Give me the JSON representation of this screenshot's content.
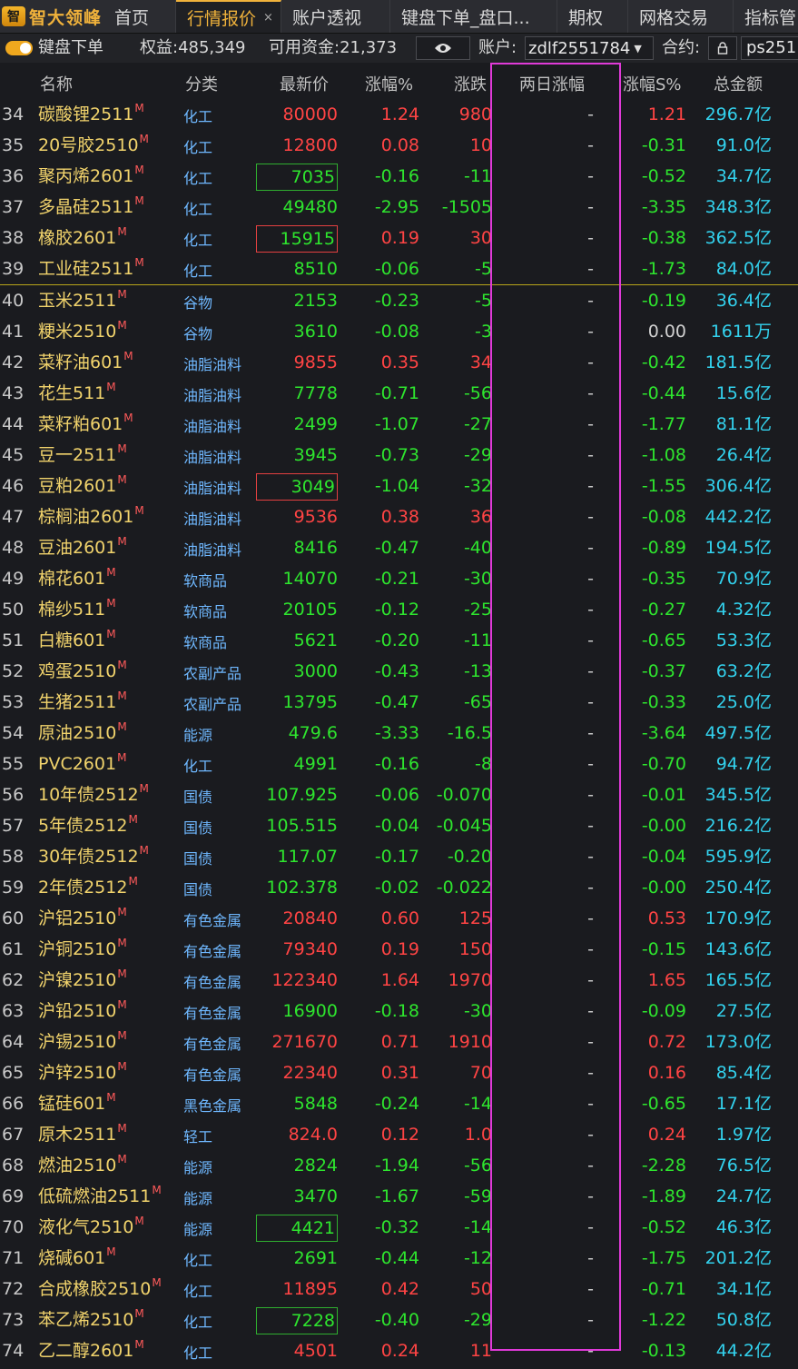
{
  "brand": {
    "name": "智大领峰",
    "mark": "智"
  },
  "tabs": [
    {
      "label": "首页"
    },
    {
      "label": "行情报价",
      "close": "×"
    },
    {
      "label": "账户透视"
    },
    {
      "label": "键盘下单_盘口..."
    },
    {
      "label": "期权"
    },
    {
      "label": "网格交易"
    },
    {
      "label": "指标管"
    }
  ],
  "toolbar": {
    "toggle_label": "键盘下单",
    "equity": "权益:485,349",
    "available": "可用资金:21,373",
    "account_label": "账户:",
    "account_value": "zdlf2551784",
    "contract_label": "合约:",
    "contract_value": "ps251"
  },
  "columns": [
    "名称",
    "分类",
    "最新价",
    "涨幅%",
    "涨跌",
    "两日涨幅",
    "涨幅S%",
    "总金额"
  ],
  "rows": [
    {
      "idx": "34",
      "name": "碳酸锂2511",
      "mark": "M",
      "cat": "化工",
      "price": "80000",
      "pct": "1.24",
      "chg": "980",
      "two": "-",
      "pcts": "1.21",
      "amt": "296.7亿",
      "dir": "up",
      "sdir": "up"
    },
    {
      "idx": "35",
      "name": "20号胶2510",
      "mark": "M",
      "cat": "化工",
      "price": "12800",
      "pct": "0.08",
      "chg": "10",
      "two": "-",
      "pcts": "-0.31",
      "amt": "91.0亿",
      "dir": "up",
      "sdir": "down"
    },
    {
      "idx": "36",
      "name": "聚丙烯2601",
      "mark": "M",
      "cat": "化工",
      "price": "7035",
      "pct": "-0.16",
      "chg": "-11",
      "two": "-",
      "pcts": "-0.52",
      "amt": "34.7亿",
      "dir": "down",
      "sdir": "down",
      "boxed": true
    },
    {
      "idx": "37",
      "name": "多晶硅2511",
      "mark": "M",
      "cat": "化工",
      "price": "49480",
      "pct": "-2.95",
      "chg": "-1505",
      "two": "-",
      "pcts": "-3.35",
      "amt": "348.3亿",
      "dir": "down",
      "sdir": "down"
    },
    {
      "idx": "38",
      "name": "橡胶2601",
      "mark": "M",
      "cat": "化工",
      "price": "15915",
      "pct": "0.19",
      "chg": "30",
      "two": "-",
      "pcts": "-0.38",
      "amt": "362.5亿",
      "dir": "up",
      "sdir": "down",
      "boxed": true,
      "box_color": "down"
    },
    {
      "idx": "39",
      "name": "工业硅2511",
      "mark": "M",
      "cat": "化工",
      "price": "8510",
      "pct": "-0.06",
      "chg": "-5",
      "two": "-",
      "pcts": "-1.73",
      "amt": "84.0亿",
      "dir": "down",
      "sdir": "down"
    },
    {
      "idx": "40",
      "name": "玉米2511",
      "mark": "M",
      "cat": "谷物",
      "price": "2153",
      "pct": "-0.23",
      "chg": "-5",
      "two": "-",
      "pcts": "-0.19",
      "amt": "36.4亿",
      "dir": "down",
      "sdir": "down",
      "sep": true
    },
    {
      "idx": "41",
      "name": "粳米2510",
      "mark": "M",
      "cat": "谷物",
      "price": "3610",
      "pct": "-0.08",
      "chg": "-3",
      "two": "-",
      "pcts": "0.00",
      "amt": "1611万",
      "dir": "down",
      "sdir": "flat"
    },
    {
      "idx": "42",
      "name": "菜籽油601",
      "mark": "M",
      "cat": "油脂油料",
      "price": "9855",
      "pct": "0.35",
      "chg": "34",
      "two": "-",
      "pcts": "-0.42",
      "amt": "181.5亿",
      "dir": "up",
      "sdir": "down"
    },
    {
      "idx": "43",
      "name": "花生511",
      "mark": "M",
      "cat": "油脂油料",
      "price": "7778",
      "pct": "-0.71",
      "chg": "-56",
      "two": "-",
      "pcts": "-0.44",
      "amt": "15.6亿",
      "dir": "down",
      "sdir": "down"
    },
    {
      "idx": "44",
      "name": "菜籽粕601",
      "mark": "M",
      "cat": "油脂油料",
      "price": "2499",
      "pct": "-1.07",
      "chg": "-27",
      "two": "-",
      "pcts": "-1.77",
      "amt": "81.1亿",
      "dir": "down",
      "sdir": "down"
    },
    {
      "idx": "45",
      "name": "豆一2511",
      "mark": "M",
      "cat": "油脂油料",
      "price": "3945",
      "pct": "-0.73",
      "chg": "-29",
      "two": "-",
      "pcts": "-1.08",
      "amt": "26.4亿",
      "dir": "down",
      "sdir": "down"
    },
    {
      "idx": "46",
      "name": "豆粕2601",
      "mark": "M",
      "cat": "油脂油料",
      "price": "3049",
      "pct": "-1.04",
      "chg": "-32",
      "two": "-",
      "pcts": "-1.55",
      "amt": "306.4亿",
      "dir": "down",
      "sdir": "down",
      "boxed": true,
      "box_color": "up"
    },
    {
      "idx": "47",
      "name": "棕榈油2601",
      "mark": "M",
      "cat": "油脂油料",
      "price": "9536",
      "pct": "0.38",
      "chg": "36",
      "two": "-",
      "pcts": "-0.08",
      "amt": "442.2亿",
      "dir": "up",
      "sdir": "down"
    },
    {
      "idx": "48",
      "name": "豆油2601",
      "mark": "M",
      "cat": "油脂油料",
      "price": "8416",
      "pct": "-0.47",
      "chg": "-40",
      "two": "-",
      "pcts": "-0.89",
      "amt": "194.5亿",
      "dir": "down",
      "sdir": "down"
    },
    {
      "idx": "49",
      "name": "棉花601",
      "mark": "M",
      "cat": "软商品",
      "price": "14070",
      "pct": "-0.21",
      "chg": "-30",
      "two": "-",
      "pcts": "-0.35",
      "amt": "70.9亿",
      "dir": "down",
      "sdir": "down"
    },
    {
      "idx": "50",
      "name": "棉纱511",
      "mark": "M",
      "cat": "软商品",
      "price": "20105",
      "pct": "-0.12",
      "chg": "-25",
      "two": "-",
      "pcts": "-0.27",
      "amt": "4.32亿",
      "dir": "down",
      "sdir": "down"
    },
    {
      "idx": "51",
      "name": "白糖601",
      "mark": "M",
      "cat": "软商品",
      "price": "5621",
      "pct": "-0.20",
      "chg": "-11",
      "two": "-",
      "pcts": "-0.65",
      "amt": "53.3亿",
      "dir": "down",
      "sdir": "down"
    },
    {
      "idx": "52",
      "name": "鸡蛋2510",
      "mark": "M",
      "cat": "农副产品",
      "price": "3000",
      "pct": "-0.43",
      "chg": "-13",
      "two": "-",
      "pcts": "-0.37",
      "amt": "63.2亿",
      "dir": "down",
      "sdir": "down"
    },
    {
      "idx": "53",
      "name": "生猪2511",
      "mark": "M",
      "cat": "农副产品",
      "price": "13795",
      "pct": "-0.47",
      "chg": "-65",
      "two": "-",
      "pcts": "-0.33",
      "amt": "25.0亿",
      "dir": "down",
      "sdir": "down"
    },
    {
      "idx": "54",
      "name": "原油2510",
      "mark": "M",
      "cat": "能源",
      "price": "479.6",
      "pct": "-3.33",
      "chg": "-16.5",
      "two": "-",
      "pcts": "-3.64",
      "amt": "497.5亿",
      "dir": "down",
      "sdir": "down"
    },
    {
      "idx": "55",
      "name": "PVC2601",
      "mark": "M",
      "cat": "化工",
      "price": "4991",
      "pct": "-0.16",
      "chg": "-8",
      "two": "-",
      "pcts": "-0.70",
      "amt": "94.7亿",
      "dir": "down",
      "sdir": "down"
    },
    {
      "idx": "56",
      "name": "10年债2512",
      "mark": "M",
      "cat": "国债",
      "price": "107.925",
      "pct": "-0.06",
      "chg": "-0.070",
      "two": "-",
      "pcts": "-0.01",
      "amt": "345.5亿",
      "dir": "down",
      "sdir": "down"
    },
    {
      "idx": "57",
      "name": "5年债2512",
      "mark": "M",
      "cat": "国债",
      "price": "105.515",
      "pct": "-0.04",
      "chg": "-0.045",
      "two": "-",
      "pcts": "-0.00",
      "amt": "216.2亿",
      "dir": "down",
      "sdir": "down"
    },
    {
      "idx": "58",
      "name": "30年债2512",
      "mark": "M",
      "cat": "国债",
      "price": "117.07",
      "pct": "-0.17",
      "chg": "-0.20",
      "two": "-",
      "pcts": "-0.04",
      "amt": "595.9亿",
      "dir": "down",
      "sdir": "down"
    },
    {
      "idx": "59",
      "name": "2年债2512",
      "mark": "M",
      "cat": "国债",
      "price": "102.378",
      "pct": "-0.02",
      "chg": "-0.022",
      "two": "-",
      "pcts": "-0.00",
      "amt": "250.4亿",
      "dir": "down",
      "sdir": "down"
    },
    {
      "idx": "60",
      "name": "沪铝2510",
      "mark": "M",
      "cat": "有色金属",
      "price": "20840",
      "pct": "0.60",
      "chg": "125",
      "two": "-",
      "pcts": "0.53",
      "amt": "170.9亿",
      "dir": "up",
      "sdir": "up"
    },
    {
      "idx": "61",
      "name": "沪铜2510",
      "mark": "M",
      "cat": "有色金属",
      "price": "79340",
      "pct": "0.19",
      "chg": "150",
      "two": "-",
      "pcts": "-0.15",
      "amt": "143.6亿",
      "dir": "up",
      "sdir": "down"
    },
    {
      "idx": "62",
      "name": "沪镍2510",
      "mark": "M",
      "cat": "有色金属",
      "price": "122340",
      "pct": "1.64",
      "chg": "1970",
      "two": "-",
      "pcts": "1.65",
      "amt": "165.5亿",
      "dir": "up",
      "sdir": "up"
    },
    {
      "idx": "63",
      "name": "沪铅2510",
      "mark": "M",
      "cat": "有色金属",
      "price": "16900",
      "pct": "-0.18",
      "chg": "-30",
      "two": "-",
      "pcts": "-0.09",
      "amt": "27.5亿",
      "dir": "down",
      "sdir": "down"
    },
    {
      "idx": "64",
      "name": "沪锡2510",
      "mark": "M",
      "cat": "有色金属",
      "price": "271670",
      "pct": "0.71",
      "chg": "1910",
      "two": "-",
      "pcts": "0.72",
      "amt": "173.0亿",
      "dir": "up",
      "sdir": "up"
    },
    {
      "idx": "65",
      "name": "沪锌2510",
      "mark": "M",
      "cat": "有色金属",
      "price": "22340",
      "pct": "0.31",
      "chg": "70",
      "two": "-",
      "pcts": "0.16",
      "amt": "85.4亿",
      "dir": "up",
      "sdir": "up"
    },
    {
      "idx": "66",
      "name": "锰硅601",
      "mark": "M",
      "cat": "黑色金属",
      "price": "5848",
      "pct": "-0.24",
      "chg": "-14",
      "two": "-",
      "pcts": "-0.65",
      "amt": "17.1亿",
      "dir": "down",
      "sdir": "down"
    },
    {
      "idx": "67",
      "name": "原木2511",
      "mark": "M",
      "cat": "轻工",
      "price": "824.0",
      "pct": "0.12",
      "chg": "1.0",
      "two": "-",
      "pcts": "0.24",
      "amt": "1.97亿",
      "dir": "up",
      "sdir": "up"
    },
    {
      "idx": "68",
      "name": "燃油2510",
      "mark": "M",
      "cat": "能源",
      "price": "2824",
      "pct": "-1.94",
      "chg": "-56",
      "two": "-",
      "pcts": "-2.28",
      "amt": "76.5亿",
      "dir": "down",
      "sdir": "down"
    },
    {
      "idx": "69",
      "name": "低硫燃油2511",
      "mark": "M",
      "cat": "能源",
      "price": "3470",
      "pct": "-1.67",
      "chg": "-59",
      "two": "-",
      "pcts": "-1.89",
      "amt": "24.7亿",
      "dir": "down",
      "sdir": "down"
    },
    {
      "idx": "70",
      "name": "液化气2510",
      "mark": "M",
      "cat": "能源",
      "price": "4421",
      "pct": "-0.32",
      "chg": "-14",
      "two": "-",
      "pcts": "-0.52",
      "amt": "46.3亿",
      "dir": "down",
      "sdir": "down",
      "boxed": true
    },
    {
      "idx": "71",
      "name": "烧碱601",
      "mark": "M",
      "cat": "化工",
      "price": "2691",
      "pct": "-0.44",
      "chg": "-12",
      "two": "-",
      "pcts": "-1.75",
      "amt": "201.2亿",
      "dir": "down",
      "sdir": "down"
    },
    {
      "idx": "72",
      "name": "合成橡胶2510",
      "mark": "M",
      "cat": "化工",
      "price": "11895",
      "pct": "0.42",
      "chg": "50",
      "two": "-",
      "pcts": "-0.71",
      "amt": "34.1亿",
      "dir": "up",
      "sdir": "down"
    },
    {
      "idx": "73",
      "name": "苯乙烯2510",
      "mark": "M",
      "cat": "化工",
      "price": "7228",
      "pct": "-0.40",
      "chg": "-29",
      "two": "-",
      "pcts": "-1.22",
      "amt": "50.8亿",
      "dir": "down",
      "sdir": "down",
      "boxed": true
    },
    {
      "idx": "74",
      "name": "乙二醇2601",
      "mark": "M",
      "cat": "化工",
      "price": "4501",
      "pct": "0.24",
      "chg": "11",
      "two": "-",
      "pcts": "-0.13",
      "amt": "44.2亿",
      "dir": "up",
      "sdir": "down"
    }
  ],
  "colors": {
    "up": "#ff4444",
    "down": "#2ee52e",
    "amount": "#33d2ee",
    "name": "#f1d36c",
    "category": "#6fb8ff",
    "highlight": "#e03ad8",
    "accent": "#f0b23b"
  },
  "icons": {
    "eye": "eye-icon",
    "lock": "lock-icon",
    "dropdown": "chevron-down-icon"
  }
}
